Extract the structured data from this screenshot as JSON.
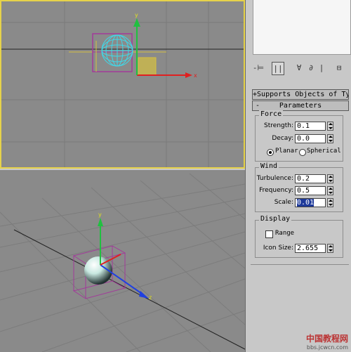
{
  "toolbar": {
    "icons": [
      "pin-icon",
      "modifier-stack-icon",
      "show-end-result-icon",
      "make-unique-icon",
      "remove-modifier-icon",
      "configure-sets-icon"
    ],
    "pin_glyph": "-⊨",
    "stack_glyph": "||",
    "result_glyph": "∀",
    "unique_glyph": "∂",
    "remove_glyph": "|",
    "config_glyph": "⊟"
  },
  "rollouts": {
    "supports": "Supports Objects of Typ",
    "supports_sign": "+",
    "parameters": "Parameters",
    "parameters_sign": "-"
  },
  "force": {
    "title": "Force",
    "strength_label": "Strength:",
    "strength_value": "0.1",
    "decay_label": "Decay:",
    "decay_value": "0.0",
    "mode_planar": "Planar",
    "mode_spherical": "Spherical",
    "mode_selected": "Planar"
  },
  "wind": {
    "title": "Wind",
    "turbulence_label": "Turbulence:",
    "turbulence_value": "0.2",
    "frequency_label": "Frequency:",
    "frequency_value": "0.5",
    "scale_label": "Scale:",
    "scale_value": "0.01"
  },
  "display": {
    "title": "Display",
    "range_label": "Range",
    "range_checked": false,
    "icon_size_label": "Icon Size:",
    "icon_size_value": "2.655"
  },
  "viewport_axes": {
    "x": "x",
    "y": "y",
    "z": "z"
  },
  "watermark": {
    "line1": "中国教程网",
    "line2": "bbs.jcwcn.com"
  },
  "colors": {
    "active_border": "#e6d24a",
    "viewport_bg": "#8a8a8a",
    "grid": "#7a7a7a",
    "selection": "#a23a9a",
    "axis_x": "#e02020",
    "axis_y": "#20c040",
    "axis_z": "#2040e0"
  }
}
